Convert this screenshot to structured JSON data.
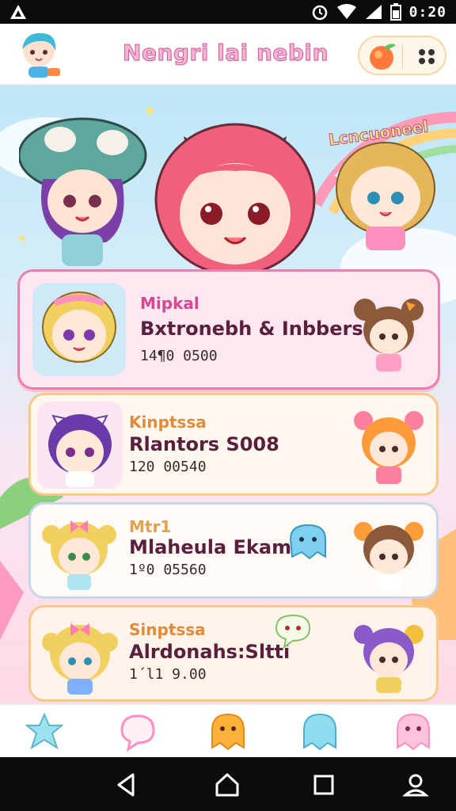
{
  "status_bar": {
    "time": "0:20",
    "icons": [
      "app-notification-icon",
      "alarm-icon",
      "wifi-icon",
      "signal-icon",
      "battery-icon"
    ]
  },
  "header": {
    "title": "Nengri lai nebin",
    "avatar_icon": "chibi-avatar",
    "fruit_icon": "carrot-fruit-icon",
    "menu_icon": "four-dots-menu-icon"
  },
  "scene": {
    "badge_text": "Lcncuoneel"
  },
  "cards": [
    {
      "subtitle": "Mipkal",
      "title": "Bxtronebh & Inbbers",
      "meta": "14¶0 0500",
      "subtitle_color": "#d6478f"
    },
    {
      "subtitle": "Kinptssa",
      "title": "Rlantors S008",
      "meta": "120 00540",
      "subtitle_color": "#e08a3a"
    },
    {
      "subtitle": "Mtr1",
      "title": "Mlaheula Ekam",
      "meta": "1º0 05560",
      "subtitle_color": "#e0a24a"
    },
    {
      "subtitle": "Sinptssa",
      "title": "Alrdonahs:Sltti",
      "meta": "1´l1 9.00",
      "subtitle_color": "#e08a3a"
    }
  ],
  "bottom_nav": [
    "star-blob-icon",
    "speech-bubble-icon",
    "orange-blob-icon",
    "blue-blob-icon",
    "pink-blob-icon"
  ],
  "system_nav": [
    "back-icon",
    "home-icon",
    "recents-icon",
    "profile-icon"
  ]
}
